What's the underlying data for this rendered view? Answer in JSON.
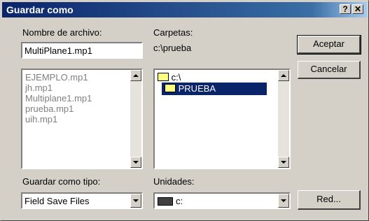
{
  "window": {
    "title": "Guardar como",
    "help": "?",
    "close": "✕"
  },
  "file_name": {
    "label": "Nombre de archivo:",
    "value": "MultiPlane1.mp1"
  },
  "file_list": [
    "EJEMPLO.mp1",
    "jh.mp1",
    "Multiplane1.mp1",
    "prueba.mp1",
    "uih.mp1"
  ],
  "folders": {
    "label": "Carpetas:",
    "current_path": "c:\\prueba",
    "items": [
      {
        "label": "c:\\",
        "selected": false
      },
      {
        "label": "PRUEBA",
        "selected": true
      }
    ]
  },
  "file_type": {
    "label": "Guardar como tipo:",
    "value": "Field Save Files"
  },
  "drives": {
    "label": "Unidades:",
    "value": "c:"
  },
  "buttons": {
    "ok": "Aceptar",
    "cancel": "Cancelar",
    "network": "Red..."
  },
  "icons": {
    "folder": "folder-icon",
    "drive": "drive-icon"
  }
}
